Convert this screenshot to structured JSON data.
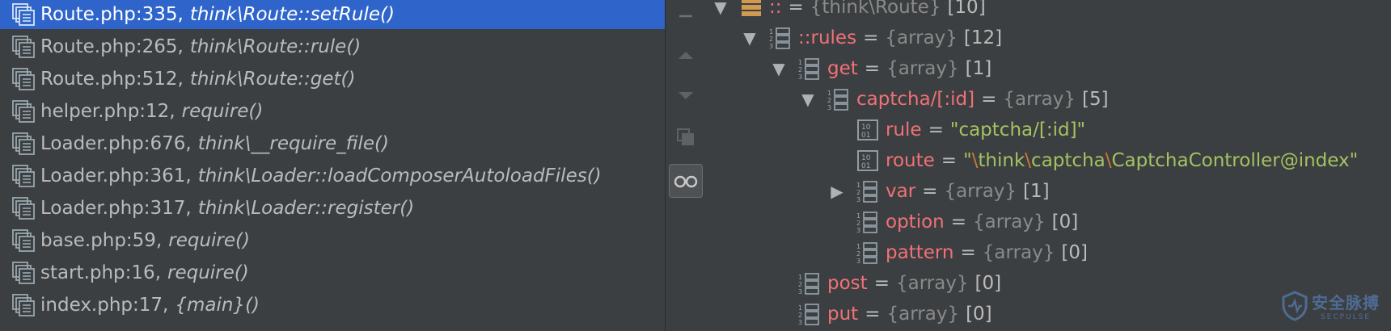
{
  "frames": [
    {
      "file": "Route.php:335",
      "sep": ",",
      "method": "think\\Route::setRule()"
    },
    {
      "file": "Route.php:265",
      "sep": ",",
      "method": "think\\Route::rule()"
    },
    {
      "file": "Route.php:512",
      "sep": ",",
      "method": "think\\Route::get()"
    },
    {
      "file": "helper.php:12",
      "sep": ",",
      "method": "require()"
    },
    {
      "file": "Loader.php:676",
      "sep": ",",
      "method": "think\\__require_file()"
    },
    {
      "file": "Loader.php:361",
      "sep": ",",
      "method": "think\\Loader::loadComposerAutoloadFiles()"
    },
    {
      "file": "Loader.php:317",
      "sep": ",",
      "method": "think\\Loader::register()"
    },
    {
      "file": "base.php:59",
      "sep": ",",
      "method": "require()"
    },
    {
      "file": "start.php:16",
      "sep": ",",
      "method": "require()"
    },
    {
      "file": "index.php:17",
      "sep": ",",
      "method": "{main}()"
    }
  ],
  "selected_frame": 0,
  "toolbar": {
    "icons": [
      "minus-icon",
      "up-arrow-icon",
      "down-arrow-icon",
      "copy-icon",
      "glasses-icon"
    ]
  },
  "variables": {
    "root": {
      "name": "::",
      "eq": "=",
      "type": "{think\\Route}",
      "count": "[10]"
    },
    "rules": {
      "name": "::rules",
      "eq": "=",
      "type": "{array}",
      "count": "[12]"
    },
    "get": {
      "name": "get",
      "eq": "=",
      "type": "{array}",
      "count": "[1]"
    },
    "captcha": {
      "name": "captcha/[:id]",
      "eq": "=",
      "type": "{array}",
      "count": "[5]"
    },
    "rule": {
      "name": "rule",
      "eq": "=",
      "value": "\"captcha/[:id]\""
    },
    "route": {
      "name": "route",
      "eq": "=",
      "value_parts": [
        "\"",
        "\\",
        "think",
        "\\",
        "captcha",
        "\\",
        "CaptchaController@index\""
      ]
    },
    "var": {
      "name": "var",
      "eq": "=",
      "type": "{array}",
      "count": "[1]"
    },
    "option": {
      "name": "option",
      "eq": "=",
      "type": "{array}",
      "count": "[0]"
    },
    "pattern": {
      "name": "pattern",
      "eq": "=",
      "type": "{array}",
      "count": "[0]"
    },
    "post": {
      "name": "post",
      "eq": "=",
      "type": "{array}",
      "count": "[0]"
    },
    "put": {
      "name": "put",
      "eq": "=",
      "type": "{array}",
      "count": "[0]"
    }
  },
  "watermark": {
    "cn": "安全脉搏",
    "en": "SECPULSE"
  },
  "colors": {
    "background": "#3c3f41",
    "selection": "#2f65ca",
    "var_name": "#f07178",
    "string_value": "#a5c261",
    "type_text": "#8a8a8a"
  }
}
